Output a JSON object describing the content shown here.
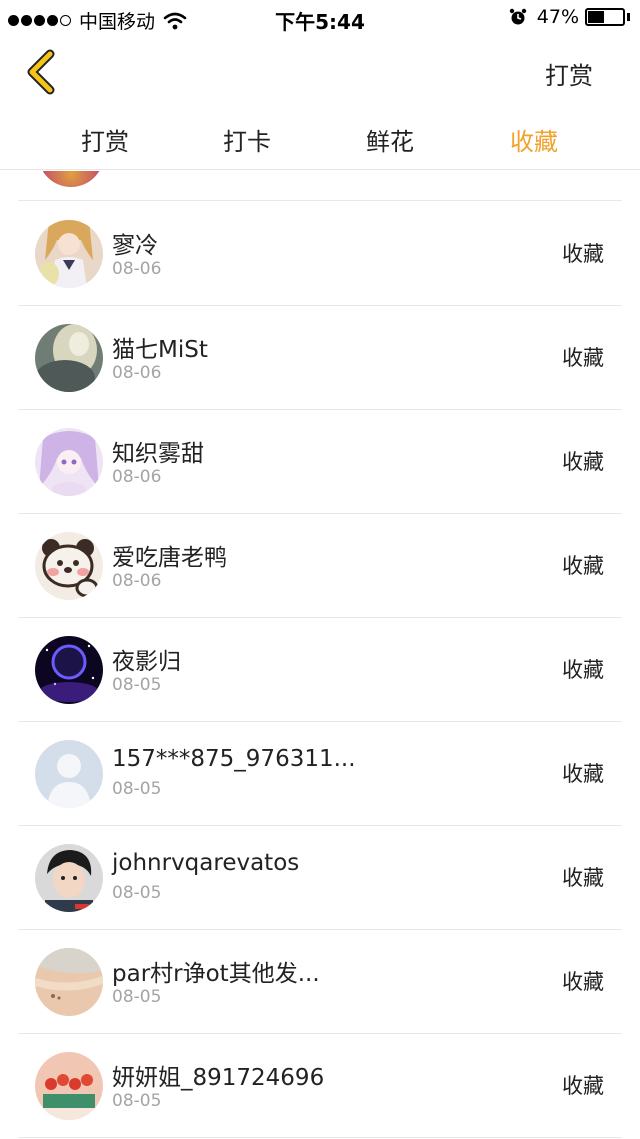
{
  "status_bar": {
    "carrier": "中国移动",
    "time": "下午5:44",
    "battery": "47%",
    "battery_level": 0.47,
    "signal_icon": "signal-dots-icon",
    "wifi_icon": "wifi-icon",
    "alarm_icon": "alarm-clock-icon"
  },
  "nav": {
    "back_icon": "chevron-left-icon",
    "right_action": "打赏",
    "back_color": "#f5c518"
  },
  "tabs": [
    {
      "label": "打赏",
      "active": false
    },
    {
      "label": "打卡",
      "active": false
    },
    {
      "label": "鲜花",
      "active": false
    },
    {
      "label": "收藏",
      "active": true
    }
  ],
  "accent_color": "#f0a22c",
  "items": [
    {
      "name": "寥冷",
      "date": "08-06",
      "action": "收藏",
      "avatar": "anime-girl-avatar"
    },
    {
      "name": "猫七MiSt",
      "date": "08-06",
      "action": "收藏",
      "avatar": "blurred-figure-avatar"
    },
    {
      "name": "知织雾甜",
      "date": "08-06",
      "action": "收藏",
      "avatar": "purple-anime-avatar"
    },
    {
      "name": "爱吃唐老鸭",
      "date": "08-06",
      "action": "收藏",
      "avatar": "cartoon-bear-avatar"
    },
    {
      "name": "夜影归",
      "date": "08-05",
      "action": "收藏",
      "avatar": "galaxy-avatar"
    },
    {
      "name": "157***875_976311...",
      "date": "08-05",
      "action": "收藏",
      "avatar": "default-person-avatar"
    },
    {
      "name": "johnrvqarevatos",
      "date": "08-05",
      "action": "收藏",
      "avatar": "boy-photo-avatar"
    },
    {
      "name": "par村r诤ot其他发...",
      "date": "08-05",
      "action": "收藏",
      "avatar": "beach-avatar"
    },
    {
      "name": "妍妍姐_891724696",
      "date": "08-05",
      "action": "收藏",
      "avatar": "flowers-avatar"
    }
  ]
}
